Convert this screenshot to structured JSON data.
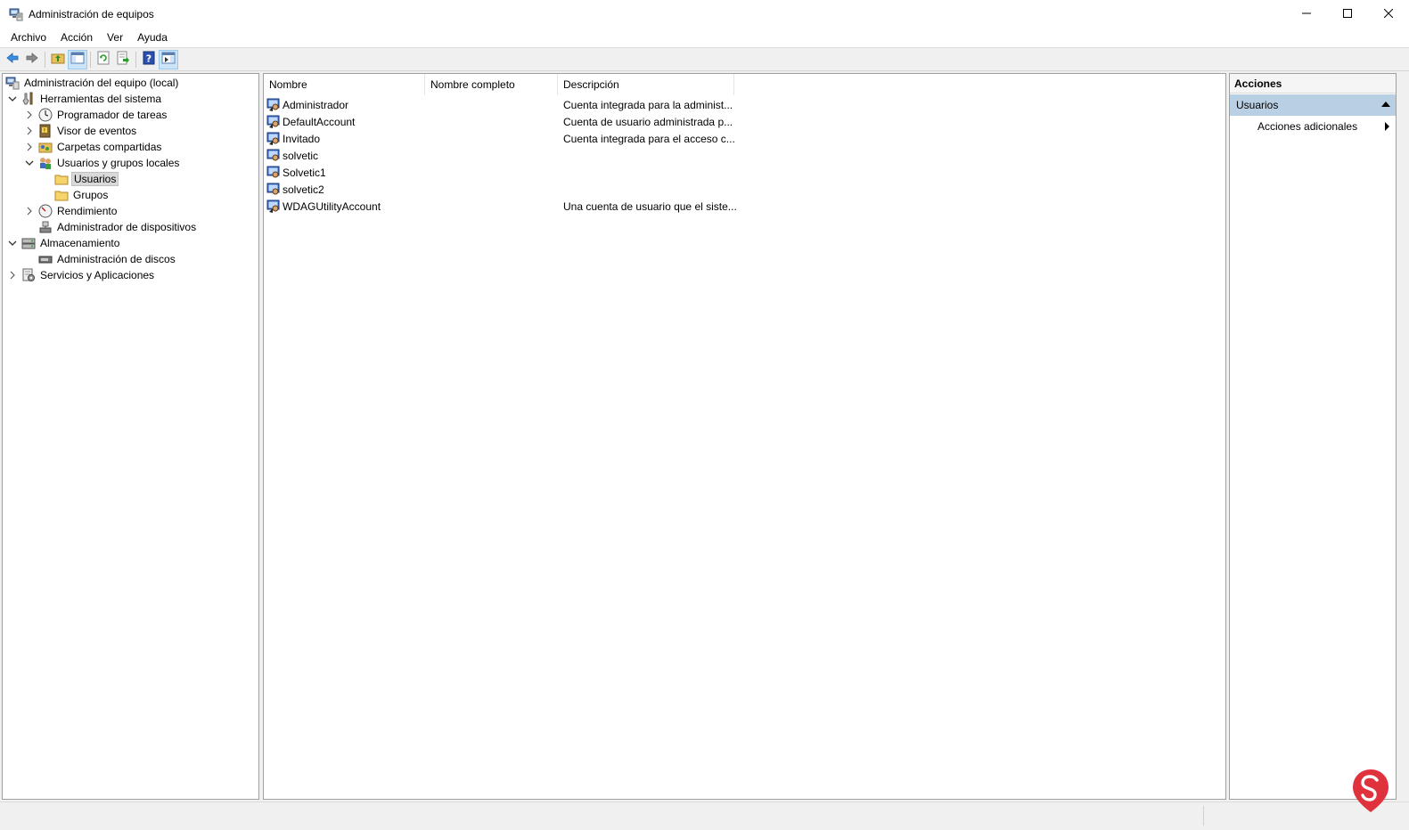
{
  "window": {
    "title": "Administración de equipos",
    "minimize_icon": "minimize-icon",
    "maximize_icon": "maximize-icon",
    "close_icon": "close-icon"
  },
  "menu": [
    "Archivo",
    "Acción",
    "Ver",
    "Ayuda"
  ],
  "toolbar": {
    "buttons": [
      "back-arrow-icon",
      "forward-arrow-icon",
      "up-folder-icon",
      "show-hide-tree-icon",
      "refresh-icon",
      "export-list-icon",
      "help-icon",
      "show-hide-actions-icon"
    ]
  },
  "tree": [
    {
      "label": "Administración del equipo (local)",
      "icon": "computer-management-icon",
      "level": 0,
      "expander": "none"
    },
    {
      "label": "Herramientas del sistema",
      "icon": "system-tools-icon",
      "level": 0,
      "expander": "expanded"
    },
    {
      "label": "Programador de tareas",
      "icon": "task-scheduler-icon",
      "level": 1,
      "expander": "collapsed"
    },
    {
      "label": "Visor de eventos",
      "icon": "event-viewer-icon",
      "level": 1,
      "expander": "collapsed"
    },
    {
      "label": "Carpetas compartidas",
      "icon": "shared-folders-icon",
      "level": 1,
      "expander": "collapsed"
    },
    {
      "label": "Usuarios y grupos locales",
      "icon": "local-users-groups-icon",
      "level": 1,
      "expander": "expanded"
    },
    {
      "label": "Usuarios",
      "icon": "folder-icon",
      "level": 2,
      "expander": "none",
      "selected": true
    },
    {
      "label": "Grupos",
      "icon": "folder-icon",
      "level": 2,
      "expander": "none"
    },
    {
      "label": "Rendimiento",
      "icon": "performance-icon",
      "level": 1,
      "expander": "collapsed"
    },
    {
      "label": "Administrador de dispositivos",
      "icon": "device-manager-icon",
      "level": 1,
      "expander": "none"
    },
    {
      "label": "Almacenamiento",
      "icon": "storage-icon",
      "level": 0,
      "expander": "expanded"
    },
    {
      "label": "Administración de discos",
      "icon": "disk-management-icon",
      "level": 1,
      "expander": "none"
    },
    {
      "label": "Servicios y Aplicaciones",
      "icon": "services-applications-icon",
      "level": 0,
      "expander": "collapsed"
    }
  ],
  "list": {
    "columns": [
      "Nombre",
      "Nombre completo",
      "Descripción"
    ],
    "rows": [
      {
        "name": "Administrador",
        "full_name": "",
        "description": "Cuenta integrada para la administ..."
      },
      {
        "name": "DefaultAccount",
        "full_name": "",
        "description": "Cuenta de usuario administrada p..."
      },
      {
        "name": "Invitado",
        "full_name": "",
        "description": "Cuenta integrada para el acceso c..."
      },
      {
        "name": "solvetic",
        "full_name": "",
        "description": ""
      },
      {
        "name": "Solvetic1",
        "full_name": "",
        "description": ""
      },
      {
        "name": "solvetic2",
        "full_name": "",
        "description": ""
      },
      {
        "name": "WDAGUtilityAccount",
        "full_name": "",
        "description": "Una cuenta de usuario que el siste..."
      }
    ],
    "row_icon": "user-account-icon"
  },
  "actions": {
    "header": "Acciones",
    "section": "Usuarios",
    "items": [
      "Acciones adicionales"
    ]
  },
  "colors": {
    "selection_section": "#b9cfe3",
    "pressed_button": "#cce4f7",
    "watermark_red": "#e0323c"
  }
}
